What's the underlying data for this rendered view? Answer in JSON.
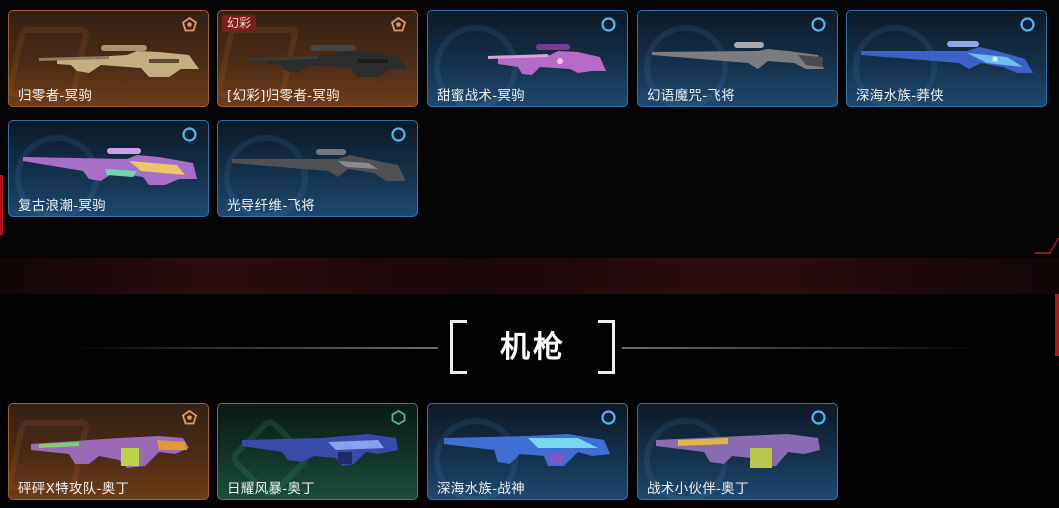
{
  "sniper_section": {
    "cards": [
      {
        "label": "归零者-冥驹",
        "rarity": "orange",
        "badge": null
      },
      {
        "label": "[幻彩]归零者-冥驹",
        "rarity": "orange",
        "badge": "幻彩"
      },
      {
        "label": "甜蜜战术-冥驹",
        "rarity": "blue",
        "badge": null
      },
      {
        "label": "幻语魔咒-飞将",
        "rarity": "blue",
        "badge": null
      },
      {
        "label": "深海水族-莽侠",
        "rarity": "blue",
        "badge": null
      },
      {
        "label": "复古浪潮-冥驹",
        "rarity": "blue",
        "badge": null
      },
      {
        "label": "光导纤维-飞将",
        "rarity": "blue",
        "badge": null
      }
    ]
  },
  "machine_gun_section": {
    "title": "机枪",
    "cards": [
      {
        "label": "砰砰X特攻队-奥丁",
        "rarity": "orange"
      },
      {
        "label": "日耀风暴-奥丁",
        "rarity": "green"
      },
      {
        "label": "深海水族-战神",
        "rarity": "blue"
      },
      {
        "label": "战术小伙伴-奥丁",
        "rarity": "blue"
      }
    ]
  },
  "colors": {
    "orange_tier": "#e39a5c",
    "blue_tier": "#4fb6ee",
    "green_tier": "#43c18e",
    "accent_red": "#b0141c"
  },
  "icons": {
    "orange_tier": "pentagon-tier-icon",
    "blue_tier": "circle-tier-icon",
    "green_tier": "hexagon-tier-icon"
  }
}
